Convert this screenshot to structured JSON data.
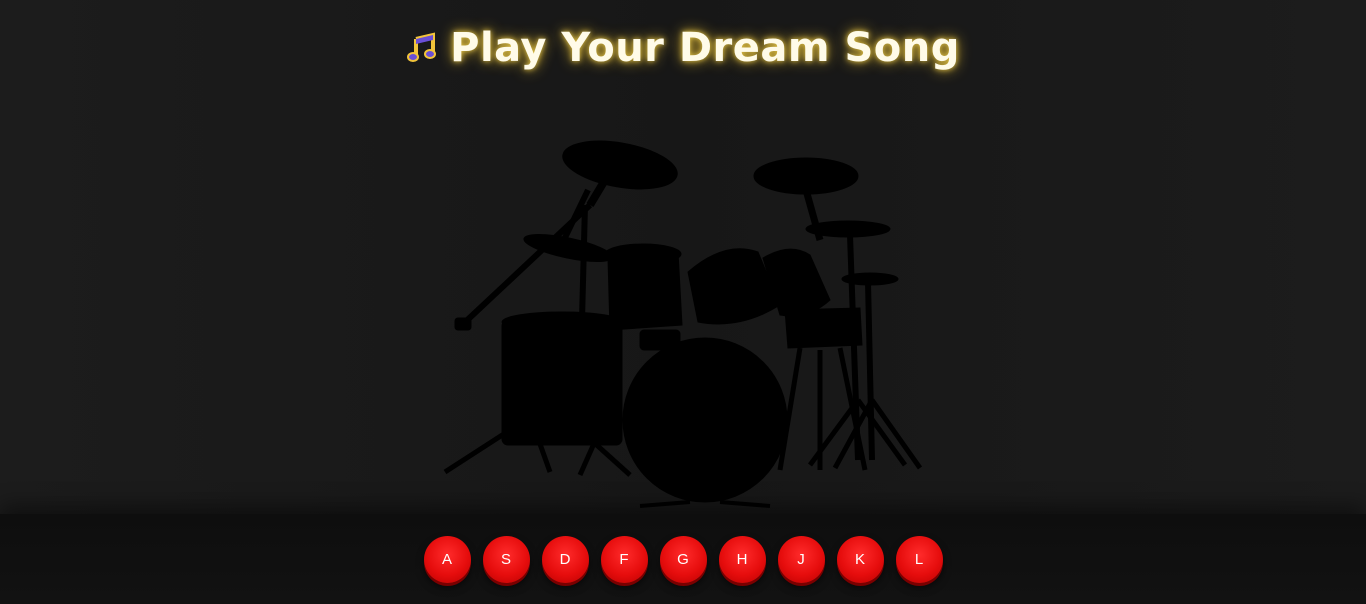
{
  "header": {
    "title": "Play Your Dream Song",
    "icon": "music-note-icon",
    "glow_color": "#e8c84a"
  },
  "drum_kit": {
    "icon": "drum-kit-silhouette"
  },
  "keys": [
    {
      "label": "A"
    },
    {
      "label": "S"
    },
    {
      "label": "D"
    },
    {
      "label": "F"
    },
    {
      "label": "G"
    },
    {
      "label": "H"
    },
    {
      "label": "J"
    },
    {
      "label": "K"
    },
    {
      "label": "L"
    }
  ],
  "colors": {
    "background": "#1c1c1c",
    "key": "#e60d0d",
    "key_text": "#ffffff"
  }
}
